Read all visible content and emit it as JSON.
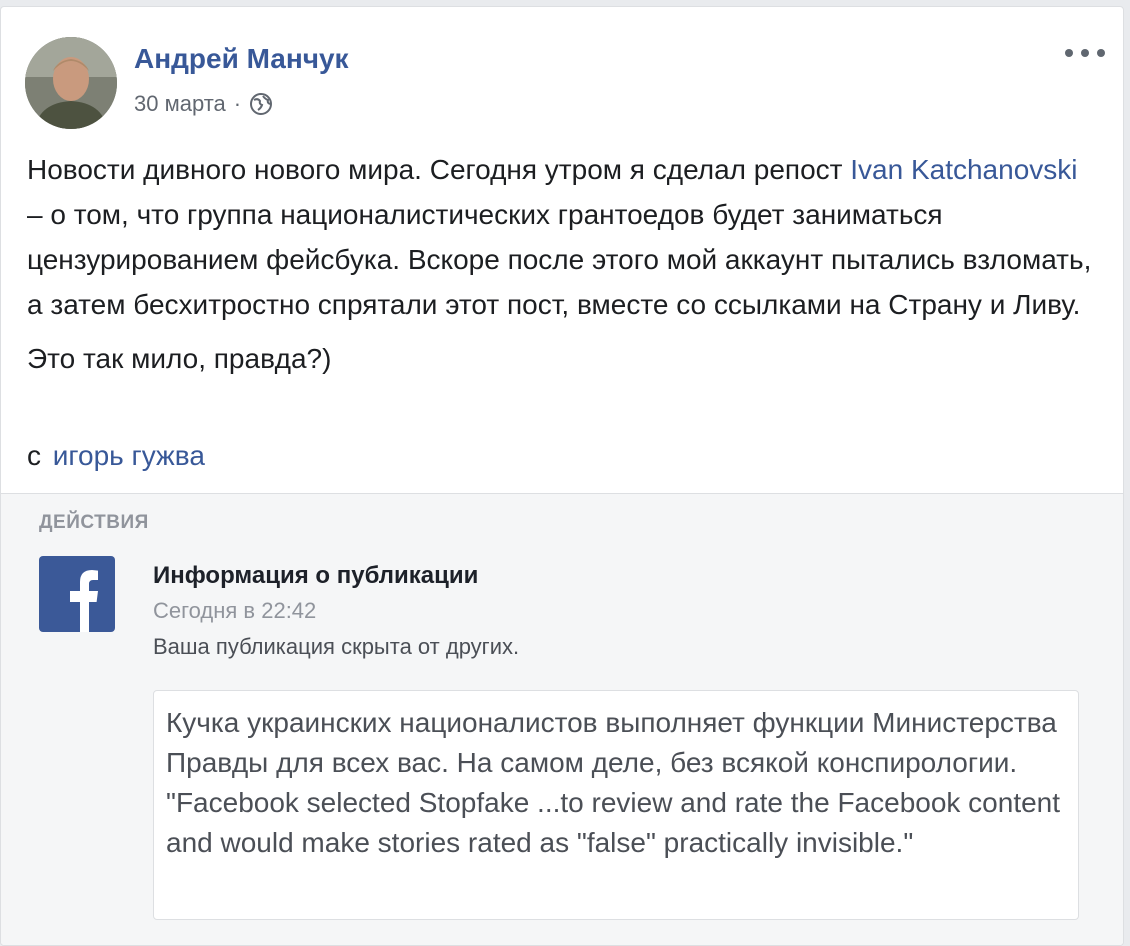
{
  "post": {
    "author": "Андрей Манчук",
    "date": "30 марта",
    "separator": "·",
    "audience_icon": "globe-icon",
    "more_icon": "more-options-icon",
    "text_part1": "Новости дивного нового мира. Сегодня утром я сделал репост ",
    "mention": "Ivan Katchanovski",
    "text_part2": " – о том, что группа националистических грантоедов будет заниматься цензурированием фейсбука. Вскоре после этого мой аккаунт пытались взломать, а затем бесхитростно спрятали этот пост, вместе со ссылками на Страну и Ливу.",
    "text_second": "Это так мило, правда?)",
    "with_prefix": "с",
    "with_person": "игорь гужва"
  },
  "actions": {
    "header": "ДЕЙСТВИЯ",
    "logo_icon": "facebook-logo-icon",
    "notification_title": "Информация о публикации",
    "notification_time": "Сегодня в 22:42",
    "notification_desc": "Ваша публикация скрыта от других.",
    "quote_text": "Кучка украинских националистов выполняет функции Министерства Правды для всех вас. На самом деле, без всякой конспирологии. \"Facebook selected Stopfake ...to review and rate the Facebook content and would make stories rated as \"false\" practically invisible.\""
  },
  "colors": {
    "link": "#385898",
    "text": "#1c1e21",
    "meta": "#616770",
    "facebook_blue": "#3b5998",
    "page_background": "#e9ebee",
    "actions_background": "#f5f6f7"
  }
}
